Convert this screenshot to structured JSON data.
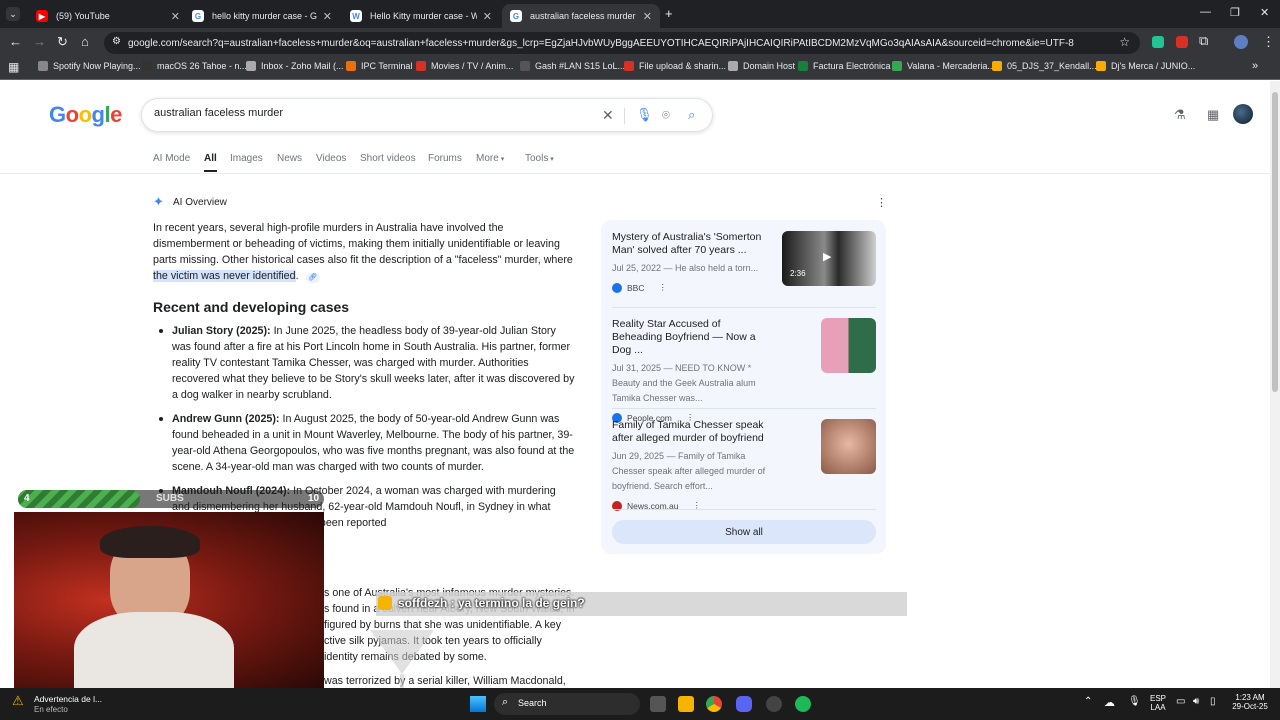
{
  "tabs": [
    {
      "title": "(59) YouTube",
      "fav": "youtube-icon",
      "color": "#ff0000",
      "glyph": "▶",
      "active": false
    },
    {
      "title": "hello kitty murder case - Googl",
      "fav": "google-icon",
      "color": "#ffffff",
      "glyph": "G",
      "active": false
    },
    {
      "title": "Hello Kitty murder case - Wikip",
      "fav": "wikipedia-icon",
      "color": "#ffffff",
      "glyph": "W",
      "active": false
    },
    {
      "title": "australian faceless murder - Go",
      "fav": "google-icon",
      "color": "#ffffff",
      "glyph": "G",
      "active": true
    }
  ],
  "address": "google.com/search?q=australian+faceless+murder&oq=australian+faceless+murder&gs_lcrp=EgZjaHJvbWUyBggAEEUYOTIHCAEQIRiPAjIHCAIQIRiPAtIBCDM2MzVqMGo3qAIAsAIA&sourceid=chrome&ie=UTF-8",
  "bookmarks": [
    {
      "label": "Spotify Now Playing...",
      "color": "#888888"
    },
    {
      "label": "macOS 26 Tahoe - n...",
      "color": "#333333"
    },
    {
      "label": "Inbox - Zoho Mail (...",
      "color": "#aaaaaa"
    },
    {
      "label": "IPC Terminal",
      "color": "#e8710a"
    },
    {
      "label": "Movies / TV / Anim...",
      "color": "#d93025"
    },
    {
      "label": "Gash #LAN S15 LoL...",
      "color": "#555555"
    },
    {
      "label": "File upload & sharin...",
      "color": "#d93025"
    },
    {
      "label": "Domain Host",
      "color": "#aaaaaa"
    },
    {
      "label": "Factura Electrónica",
      "color": "#188038"
    },
    {
      "label": "Valana - Mercaderia...",
      "color": "#34a853"
    },
    {
      "label": "05_DJS_37_Kendall...",
      "color": "#f9ab00"
    },
    {
      "label": "Dj's Merca / JUNIO...",
      "color": "#f9ab00"
    }
  ],
  "google": {
    "logo": "Google",
    "query": "australian faceless murder"
  },
  "nav": [
    "AI Mode",
    "All",
    "Images",
    "News",
    "Videos",
    "Short videos",
    "Forums",
    "More",
    "Tools"
  ],
  "ai": {
    "label": "AI Overview",
    "intro": "In recent years, several high-profile murders in Australia have involved the dismemberment or beheading of victims, making them initially unidentifiable or leaving parts missing. Other historical cases also fit the description of a \"faceless\" murder, where",
    "intro_hl": "the victim was never identified",
    "heading": "Recent and developing cases",
    "items": [
      {
        "name": "Julian Story (2025):",
        "text": "In June 2025, the headless body of 39-year-old Julian Story was found after a fire at his Port Lincoln home in South Australia. His partner, former reality TV contestant Tamika Chesser, was charged with murder. Authorities recovered what they believe to be Story's skull weeks later, after it was discovered by a dog walker in nearby scrubland."
      },
      {
        "name": "Andrew Gunn (2025):",
        "text": "In August 2025, the body of 50-year-old Andrew Gunn was found beheaded in a unit in Mount Waverley, Melbourne. The body of his partner, 39-year-old Athena Georgopoulos, who was five months pregnant, was also found at the scene. A 34-year-old man was charged with two counts of murder."
      },
      {
        "name": "Mamdouh Noufl (2024):",
        "text": "In October 2024, a woman was charged with murdering and dismembering her husband, 62-year-old Mamdouh Noufl, in Sydney in what omestic violence case. He had been reported"
      }
    ],
    "lower_lines": [
      "s one of Australia's most infamous murder mysteries.",
      "s found in a culvert near Albury, New South Wales, in",
      "figured by burns that she was unidentifiable. A key",
      "ctive silk pyjamas. It took ten years to officially",
      "identity remains debated by some.",
      "was terrorized by a serial killer, William Macdonald,"
    ]
  },
  "sources": [
    {
      "title": "Mystery of Australia's 'Somerton Man' solved after 70 years ...",
      "desc": "Jul 25, 2022 — He also held a torn...",
      "site": "BBC",
      "site_color": "#1a73e8",
      "duration": "2:36"
    },
    {
      "title": "Reality Star Accused of Beheading Boyfriend — Now a Dog ...",
      "desc": "Jul 31, 2025 — NEED TO KNOW * Beauty and the Geek Australia alum Tamika Chesser was...",
      "site": "People.com",
      "site_color": "#1a73e8"
    },
    {
      "title": "Family of Tamika Chesser speak after alleged murder of boyfriend",
      "desc": "Jun 29, 2025 — Family of Tamika Chesser speak after alleged murder of boyfriend. Search effort...",
      "site": "News.com.au",
      "site_color": "#c5221f"
    }
  ],
  "show_all": "Show all",
  "overlay": {
    "level": "4",
    "subs": "SUBS",
    "goal": "10",
    "progress": 0.4,
    "chat": "soffdezh : ya termino la de gein?"
  },
  "taskbar": {
    "notif_title": "Advertencia de l...",
    "notif_sub": "En efecto",
    "search": "Search",
    "lang1": "ESP",
    "lang2": "LAA",
    "time": "1:23 AM",
    "date": "29-Oct-25"
  }
}
